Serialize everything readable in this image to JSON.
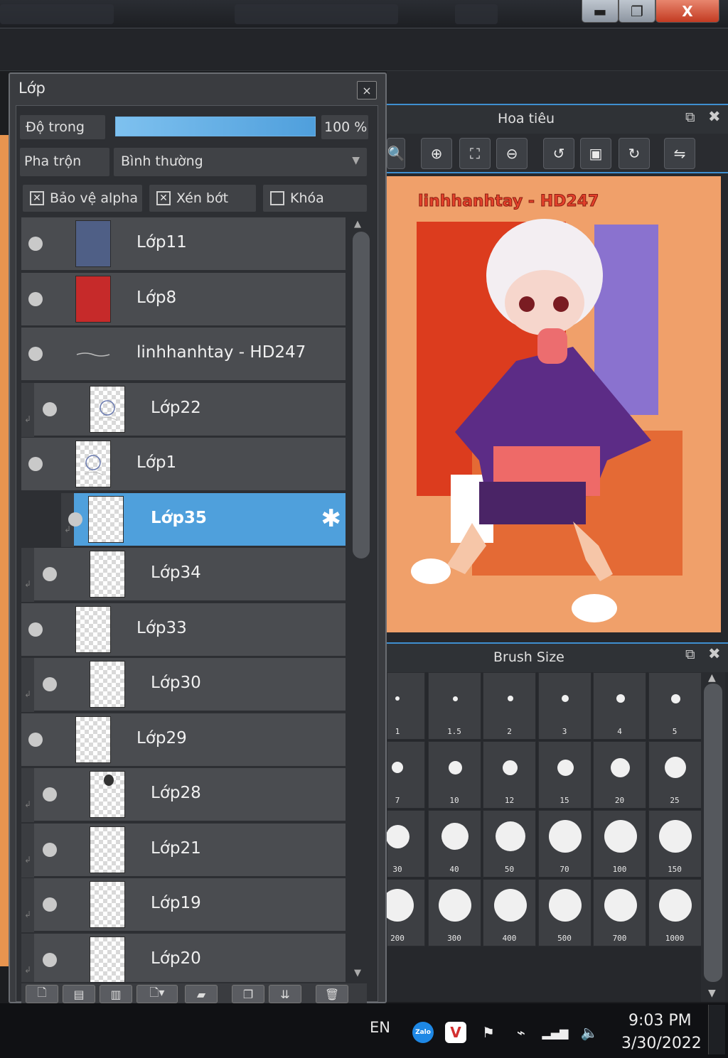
{
  "window": {
    "min": "▬",
    "max": "❐",
    "close": "X"
  },
  "layer_panel": {
    "title": "Lớp",
    "close": "×",
    "opacity_label": "Độ trong",
    "opacity_value": "100 %",
    "opacity_fraction": 1.0,
    "blend_label": "Pha trộn",
    "blend_value": "Bình thường",
    "protect_alpha": {
      "label": "Bảo vệ alpha",
      "checked": true
    },
    "clip": {
      "label": "Xén bớt",
      "checked": true
    },
    "lock": {
      "label": "Khóa",
      "checked": false
    },
    "layers": [
      {
        "name": "Lớp11",
        "indent": false,
        "selected": false,
        "thumb": "#4f5f86"
      },
      {
        "name": "Lớp8",
        "indent": false,
        "selected": false,
        "thumb": "#c62a2a"
      },
      {
        "name": "linhhanhtay - HD247",
        "indent": false,
        "selected": false,
        "thumb": "folder"
      },
      {
        "name": "Lớp22",
        "indent": true,
        "selected": false,
        "thumb": "sketch"
      },
      {
        "name": "Lớp1",
        "indent": false,
        "selected": false,
        "thumb": "sketch"
      },
      {
        "name": "Lớp35",
        "indent": true,
        "selected": true,
        "thumb": "transparent"
      },
      {
        "name": "Lớp34",
        "indent": true,
        "selected": false,
        "thumb": "transparent"
      },
      {
        "name": "Lớp33",
        "indent": false,
        "selected": false,
        "thumb": "transparent"
      },
      {
        "name": "Lớp30",
        "indent": true,
        "selected": false,
        "thumb": "transparent"
      },
      {
        "name": "Lớp29",
        "indent": false,
        "selected": false,
        "thumb": "transparent"
      },
      {
        "name": "Lớp28",
        "indent": true,
        "selected": false,
        "thumb": "dark-mark"
      },
      {
        "name": "Lớp21",
        "indent": true,
        "selected": false,
        "thumb": "transparent"
      },
      {
        "name": "Lớp19",
        "indent": true,
        "selected": false,
        "thumb": "transparent"
      },
      {
        "name": "Lớp20",
        "indent": true,
        "selected": false,
        "thumb": "transparent"
      }
    ]
  },
  "navigator": {
    "title": "Hoa tiêu",
    "tools": [
      "zoom-icon",
      "zoom-in-icon",
      "fit-icon",
      "zoom-out-icon",
      "rotate-left-icon",
      "actual-size-icon",
      "rotate-right-icon",
      "flip-icon"
    ],
    "tool_glyphs": [
      "🔍",
      "⊕",
      "⛶",
      "⊖",
      "↺",
      "▣",
      "↻",
      "⇋"
    ],
    "canvas_text": "linhhanhtay - HD247"
  },
  "brush_size": {
    "title": "Brush Size",
    "sizes": [
      "1",
      "1.5",
      "2",
      "3",
      "4",
      "5",
      "7",
      "10",
      "12",
      "15",
      "20",
      "25",
      "30",
      "40",
      "50",
      "70",
      "100",
      "150",
      "200",
      "300",
      "400",
      "500",
      "700",
      "1000"
    ]
  },
  "taskbar": {
    "language": "EN",
    "time": "9:03 PM",
    "date": "3/30/2022",
    "zalo": "Zalo",
    "v_label": "V"
  },
  "colors": {
    "accent": "#4fa0dc",
    "canvas_bg": "#f0a06a"
  }
}
